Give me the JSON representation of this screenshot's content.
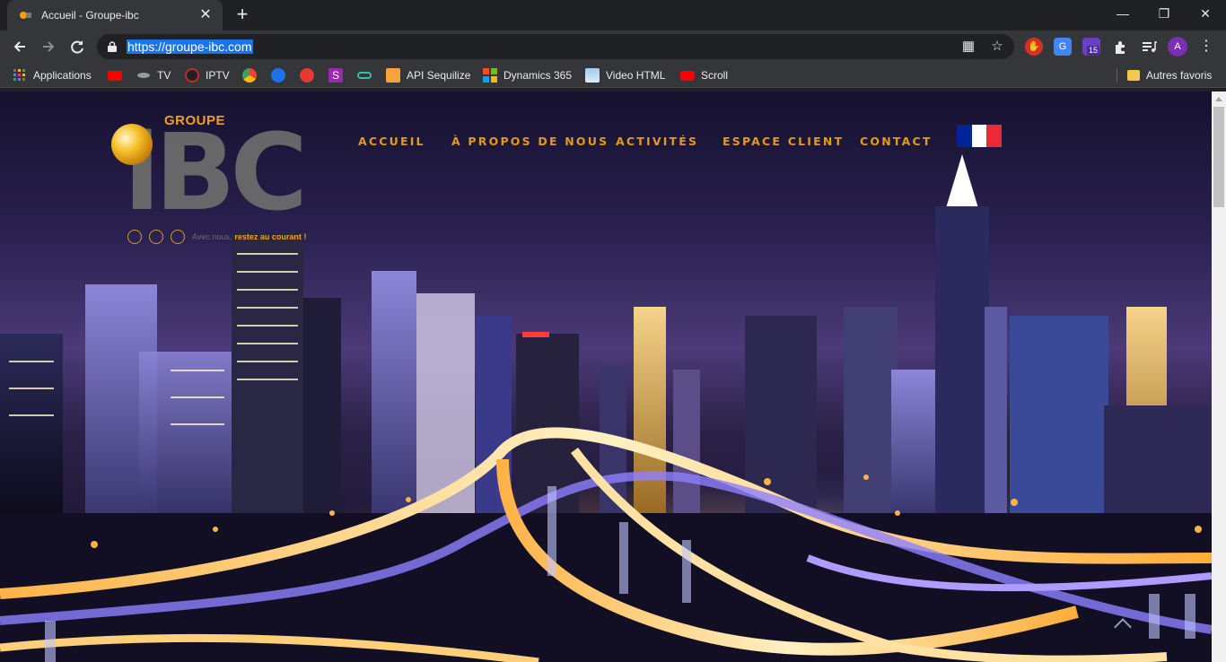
{
  "browser": {
    "tab": {
      "title": "Accueil - Groupe-ibc"
    },
    "new_tab_symbol": "+",
    "window_controls": {
      "minimize": "—",
      "maximize": "❐",
      "close": "✕"
    },
    "url": "https://groupe-ibc.com",
    "profile_initial": "A",
    "extension_badge": "15"
  },
  "bookmarks": [
    {
      "label": "Applications",
      "icon": "apps-grid-icon"
    },
    {
      "label": "",
      "icon": "youtube-icon"
    },
    {
      "label": "TV",
      "icon": "tv-icon"
    },
    {
      "label": "IPTV",
      "icon": "iptv-icon"
    },
    {
      "label": "",
      "icon": "chrome-app-icon"
    },
    {
      "label": "",
      "icon": "play-icon"
    },
    {
      "label": "",
      "icon": "red-play-icon"
    },
    {
      "label": "",
      "icon": "s-icon"
    },
    {
      "label": "",
      "icon": "link-icon"
    },
    {
      "label": "API Sequilize",
      "icon": "api-icon"
    },
    {
      "label": "Dynamics 365",
      "icon": "microsoft-icon"
    },
    {
      "label": "Video HTML",
      "icon": "image-icon"
    },
    {
      "label": "Scroll",
      "icon": "youtube-icon"
    },
    {
      "label": "Autres favoris",
      "icon": "folder-icon"
    }
  ],
  "site": {
    "logo": {
      "groupe": "GROUPE",
      "ibc": "iBC",
      "tagline_muted": "Avec nous,",
      "tagline_gold": "restez au courant !"
    },
    "nav": [
      "ACCUEIL",
      "À PROPOS DE NOUS",
      "ACTIVITÉS",
      "ESPACE CLIENT",
      "CONTACT"
    ],
    "flag_colors": [
      "#002395",
      "#ffffff",
      "#ed2939"
    ],
    "accent": "#e39a16"
  }
}
